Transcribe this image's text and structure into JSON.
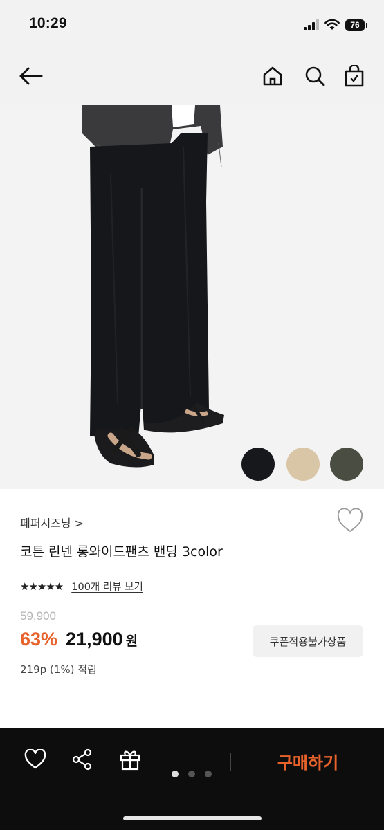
{
  "status": {
    "time": "10:29",
    "battery": "76"
  },
  "nav": {
    "back": "back-icon",
    "home": "home-icon",
    "search": "search-icon",
    "bag": "shopping-bag-icon"
  },
  "product": {
    "brand": "페퍼시즈닝 >",
    "title": "코튼 린넨 롱와이드팬츠 밴딩 3color",
    "rating_stars": "★★★★★",
    "review_link": "100개 리뷰 보기",
    "original_price": "59,900",
    "discount": "63%",
    "price": "21,900",
    "currency": "원",
    "points": "219p (1%) 적립",
    "coupon_label": "쿠폰적용불가상품",
    "swatches": [
      "#17181c",
      "#d9c6a6",
      "#4a4d42"
    ]
  },
  "bottom": {
    "buy_label": "구매하기",
    "pager_total": 3,
    "pager_active": 1
  }
}
